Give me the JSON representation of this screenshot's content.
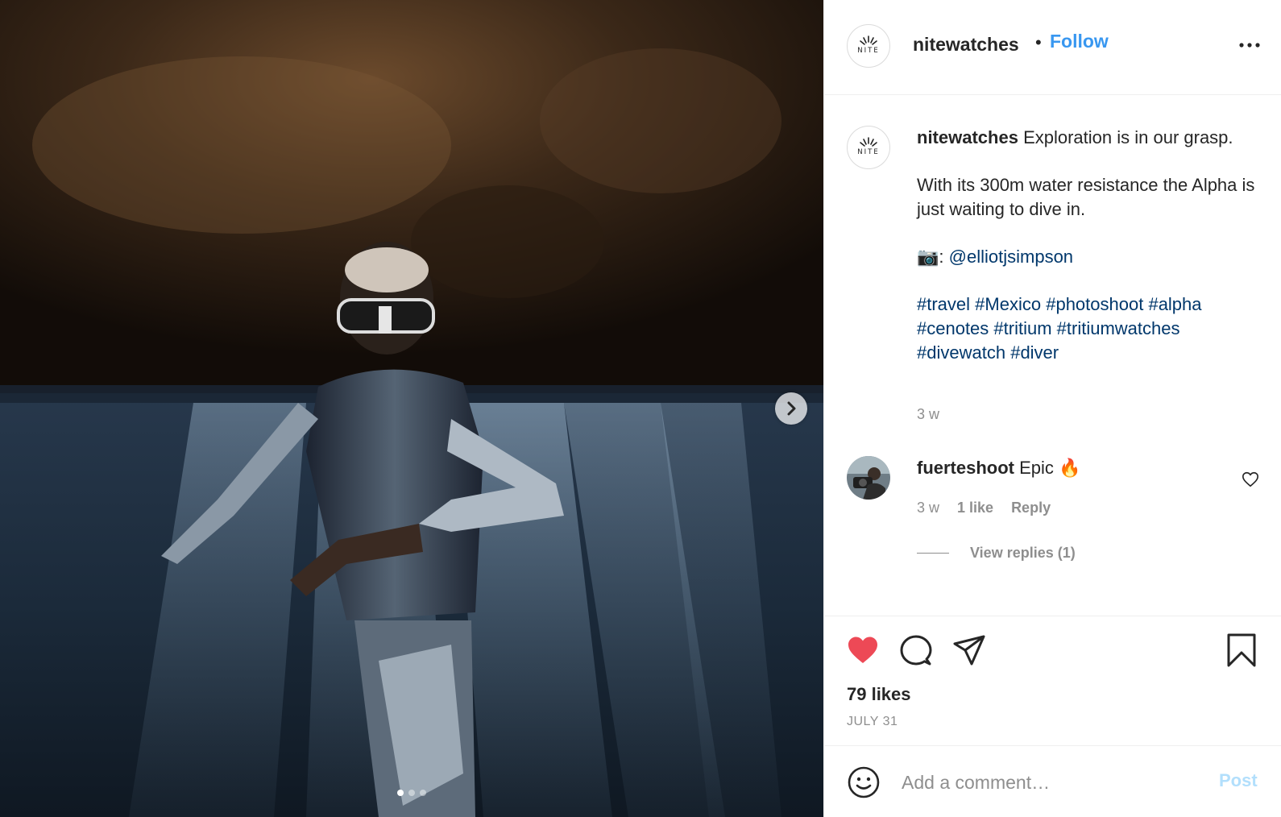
{
  "post": {
    "account": {
      "username": "nitewatches",
      "logo_text": "NITE",
      "follow_label": "Follow",
      "separator": "•"
    },
    "media": {
      "description_icon": "underwater-diver-photo",
      "carousel_count": 3,
      "carousel_active": 1
    },
    "caption": {
      "username": "nitewatches",
      "line1": "Exploration is in our grasp.",
      "line2": "With its 300m water resistance the Alpha is just waiting to dive in.",
      "camera_emoji": "📷",
      "credit_prefix": ":",
      "credit_handle": "@elliotjsimpson",
      "hashtags": [
        "#travel",
        "#Mexico",
        "#photoshoot",
        "#alpha",
        "#cenotes",
        "#tritium",
        "#tritiumwatches",
        "#divewatch",
        "#diver"
      ],
      "time": "3 w"
    },
    "comment": {
      "username": "fuerteshoot",
      "text": "Epic",
      "emoji": "🔥",
      "time": "3 w",
      "likes": "1 like",
      "reply_label": "Reply",
      "view_replies": "View replies (1)"
    },
    "likes": "79 likes",
    "date": "JULY 31",
    "add_comment": {
      "placeholder": "Add a comment…",
      "post_label": "Post"
    }
  },
  "colors": {
    "like_red": "#ed4956",
    "link_blue": "#3897f0",
    "hashtag_blue": "#00376b",
    "muted": "#8e8e8e"
  }
}
